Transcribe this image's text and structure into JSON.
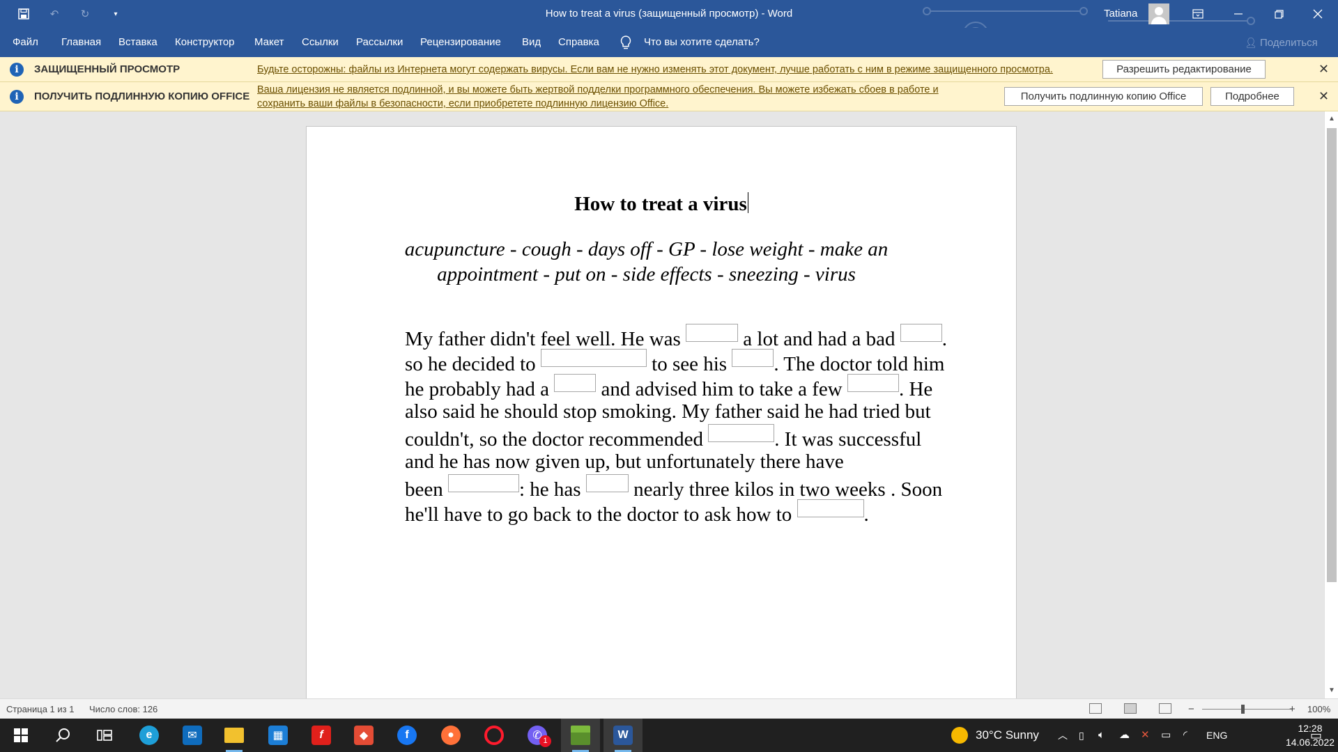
{
  "titlebar": {
    "title": "How to treat a virus (защищенный просмотр)  -  Word",
    "user": "Tatiana"
  },
  "ribbon": {
    "tabs": [
      "Файл",
      "Главная",
      "Вставка",
      "Конструктор",
      "Макет",
      "Ссылки",
      "Рассылки",
      "Рецензирование",
      "Вид",
      "Справка"
    ],
    "tell_me": "Что вы хотите сделать?",
    "share": "Поделиться"
  },
  "protected_bar": {
    "title": "ЗАЩИЩЕННЫЙ ПРОСМОТР",
    "message": "Будьте осторожны: файлы из Интернета могут содержать вирусы. Если вам не нужно изменять этот документ, лучше работать с ним в режиме защищенного просмотра.",
    "button": "Разрешить редактирование"
  },
  "license_bar": {
    "title": "ПОЛУЧИТЬ ПОДЛИННУЮ КОПИЮ OFFICE",
    "message_line1": "Ваша лицензия не является подлинной, и вы можете быть жертвой подделки программного обеспечения. Вы можете избежать сбоев в работе и",
    "message_line2": "сохранить ваши файлы в безопасности, если приобретете подлинную лицензию Office.",
    "button_primary": "Получить подлинную копию Office",
    "button_more": "Подробнее"
  },
  "document": {
    "heading": "How to treat a virus",
    "wordbank_line1": "acupuncture - cough - days off - GP - lose weight - make an",
    "wordbank_line2": "appointment - put on - side effects - sneezing - virus",
    "lines": {
      "l1a": "My father didn't feel well. He was ",
      "l1b": " a lot and had a bad ",
      "l1c": ".",
      "l2a": "so he decided to ",
      "l2b": " to see his ",
      "l2c": ". The doctor told him",
      "l3a": "he probably had a ",
      "l3b": " and advised him to take a few ",
      "l3c": ". He",
      "l4": "also said he should stop smoking. My father said he had tried but",
      "l5a": "couldn't, so the doctor recommended ",
      "l5b": ". It was successful",
      "l6": "and he has now given up, but unfortunately there have",
      "l7a": "been ",
      "l7b": ": he has ",
      "l7c": " nearly three kilos in two weeks . Soon",
      "l8a": "he'll have to go back to the doctor to ask how to ",
      "l8b": "."
    }
  },
  "status": {
    "page": "Страница 1 из 1",
    "words": "Число слов: 126",
    "zoom": "100%"
  },
  "taskbar": {
    "weather": "30°C  Sunny",
    "lang": "ENG",
    "time": "12:28",
    "date": "14.06.2022",
    "badge": "1",
    "icons": [
      "windows-start",
      "search",
      "task-view",
      "edge",
      "mail",
      "file-explorer",
      "microsoft-store",
      "flash",
      "git",
      "facebook",
      "firefox",
      "opera",
      "viber",
      "minecraft",
      "word"
    ]
  }
}
